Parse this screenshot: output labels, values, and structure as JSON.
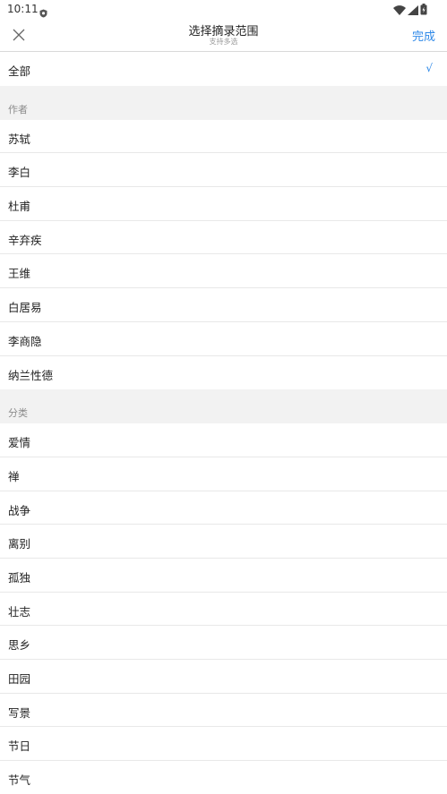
{
  "status_bar": {
    "time": "10:11"
  },
  "nav": {
    "title": "选择摘录范围",
    "subtitle": "支持多选",
    "done_label": "完成"
  },
  "all_option": {
    "label": "全部",
    "check": "√"
  },
  "sections": {
    "authors": {
      "header": "作者",
      "items": [
        "苏轼",
        "李白",
        "杜甫",
        "辛弃疾",
        "王维",
        "白居易",
        "李商隐",
        "纳兰性德"
      ]
    },
    "categories": {
      "header": "分类",
      "items": [
        "爱情",
        "禅",
        "战争",
        "离别",
        "孤独",
        "壮志",
        "思乡",
        "田园",
        "写景",
        "节日",
        "节气"
      ]
    }
  },
  "colors": {
    "accent": "#2f89e8",
    "section_bg": "#f2f2f2",
    "divider": "#e8e8e8"
  },
  "icons": {
    "close": "close-icon",
    "wifi": "wifi-icon",
    "signal": "signal-icon",
    "battery": "battery-icon",
    "shield": "shield-icon"
  }
}
